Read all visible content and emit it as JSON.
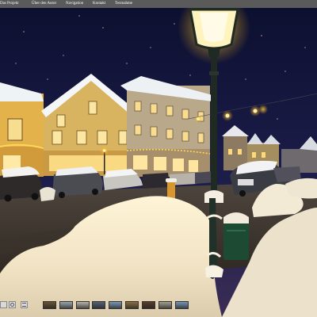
{
  "nav": {
    "items": [
      {
        "label": "Das Projekt"
      },
      {
        "label": "Über den Autor"
      },
      {
        "label": "Navigation"
      },
      {
        "label": "Kontakt"
      },
      {
        "label": "Textnahme"
      }
    ]
  },
  "panorama": {
    "controls": [
      {
        "icon": "home-icon"
      },
      {
        "icon": "camera-icon"
      },
      {
        "icon": "list-icon"
      }
    ],
    "thumbnails": [
      {
        "color": "#6a5232"
      },
      {
        "color": "#9aa4ad"
      },
      {
        "color": "#b9b4a6"
      },
      {
        "color": "#546070"
      },
      {
        "color": "#7d95b4"
      },
      {
        "color": "#8e6d3c"
      },
      {
        "color": "#5a3b2a"
      },
      {
        "color": "#a69f8d"
      },
      {
        "color": "#7796b3"
      }
    ]
  }
}
